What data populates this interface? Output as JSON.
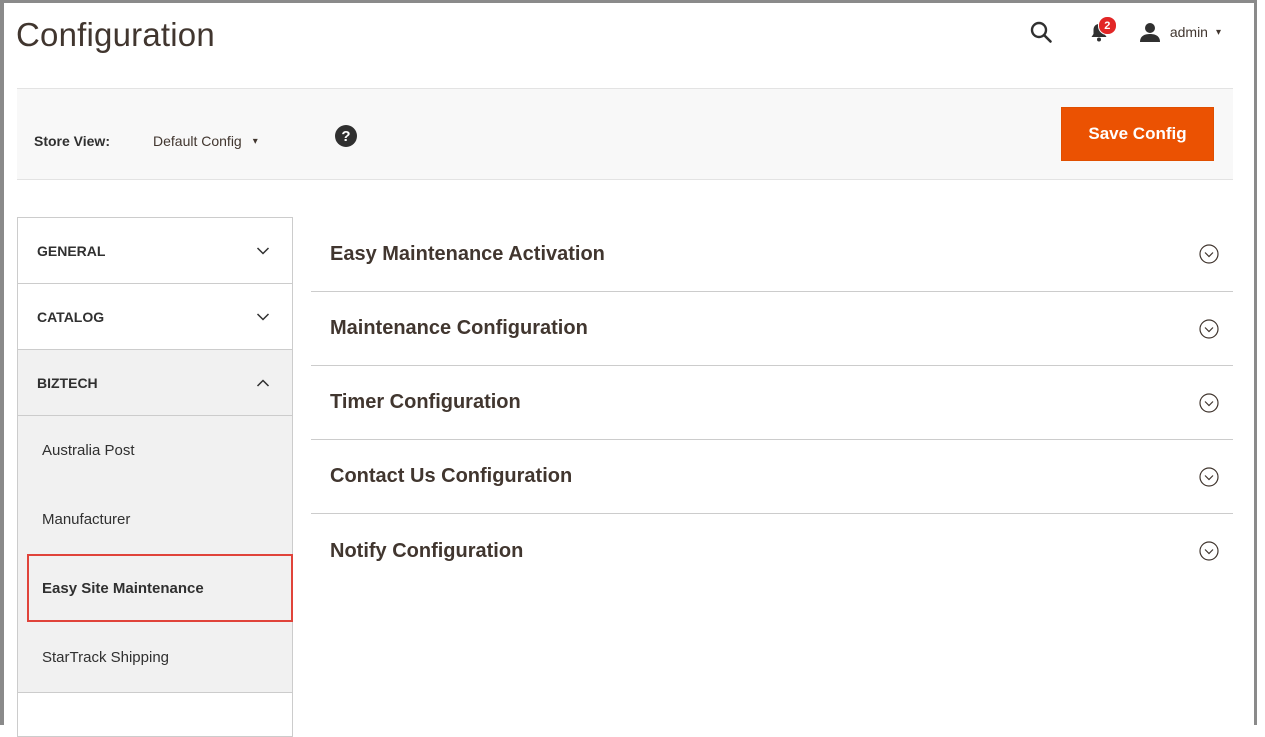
{
  "header": {
    "page_title": "Configuration",
    "notifications_count": "2",
    "user_name": "admin",
    "user_caret": "▾"
  },
  "toolbar": {
    "store_view_label": "Store View:",
    "store_view_value": "Default Config",
    "store_view_caret": "▾",
    "help_symbol": "?",
    "save_label": "Save Config"
  },
  "sidebar": {
    "sections": [
      {
        "label": "GENERAL",
        "state": "collapsed"
      },
      {
        "label": "CATALOG",
        "state": "collapsed"
      },
      {
        "label": "BIZTECH",
        "state": "expanded"
      }
    ],
    "items": [
      {
        "label": "Australia Post"
      },
      {
        "label": "Manufacturer"
      },
      {
        "label": "Easy Site Maintenance",
        "active": true
      },
      {
        "label": "StarTrack Shipping"
      }
    ]
  },
  "main": {
    "sections": [
      {
        "title": "Easy Maintenance Activation"
      },
      {
        "title": "Maintenance Configuration"
      },
      {
        "title": "Timer Configuration"
      },
      {
        "title": "Contact Us Configuration"
      },
      {
        "title": "Notify Configuration"
      }
    ]
  },
  "colors": {
    "accent": "#eb5202",
    "badge": "#e22626",
    "highlight_border": "#e0433a",
    "sidebar_open_bg": "#f1f1f1",
    "toolbar_bg": "#f8f8f8"
  },
  "icons": {
    "search": "search-icon",
    "bell": "bell-icon",
    "user": "user-icon",
    "help": "help-icon",
    "chevron_down": "chevron-down-icon",
    "chevron_up": "chevron-up-icon",
    "circle_chevron_down": "circle-chevron-down-icon"
  }
}
